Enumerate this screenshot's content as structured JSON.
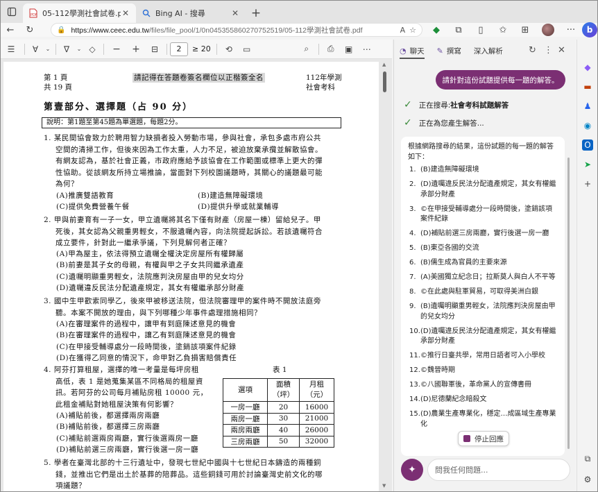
{
  "browser": {
    "tabs": [
      {
        "title": "05-112學測社會試卷.pdf",
        "active": true
      },
      {
        "title": "Bing AI - 搜尋",
        "active": false
      }
    ],
    "url_host": "https://www.ceec.edu.tw",
    "url_path": "/files/file_pool/1/0n045355860270752519/05-112學測社會試卷.pdf"
  },
  "pdf_toolbar": {
    "page_current": "2",
    "page_total_label": "≥ 20"
  },
  "pdf_page": {
    "header_left": [
      "第 1 頁",
      "共 19 頁"
    ],
    "header_center": "請記得在答題卷簽名欄位以正楷簽全名",
    "header_right": [
      "112年學測",
      "社會考科"
    ],
    "part_title": "第壹部分、選擇題（占 90 分）",
    "note": "說明：第1題至第45題為單選題，每題2分。",
    "q1": {
      "lines": [
        "1.  某民間協會致力於聘用智力缺損者投入勞動市場，參與社會，承包多處市府公共",
        "空間的清掃工作，但後來因為工作太重，人力不足，被迫放棄承攬並解散協會。",
        "有網友認為，基於社會正義，市政府應給予該協會在工作範圍或標準上更大的彈",
        "性協助。從該網友所持立場推論，當面對下列校園議題時，其關心的議題最可能",
        "為何？"
      ],
      "options": [
        "(A)推廣雙語教育",
        "(B)建造無障礙環境",
        "(C)提供免費營養午餐",
        "(D)提供升學或就業輔導"
      ]
    },
    "q2": {
      "lines": [
        "2.  甲與前妻育有一子一女，甲立遺囑將其名下僅有財產（房屋一棟）留給兒子。甲",
        "死後，其女認為父親重男輕女，不服遺囑內容，向法院提起訴訟。若該遺囑符合",
        "成立要件，針對此一繼承爭議，下列見解何者正確？"
      ],
      "options": [
        "(A)甲為屋主，依法得預立遺囑全權決定房屋所有權歸屬",
        "(B)前妻是其子女的母親，有權與甲之子女共同繼承遺產",
        "(C)遺囑明顯重男輕女，法院應判決房屋由甲的兒女均分",
        "(D)遺囑違反民法分配遺產規定，其女有權繼承部分財產"
      ]
    },
    "q3": {
      "lines": [
        "3.  國中生甲歡索同學乙，後來甲被移送法院，但法院審理甲的案件時不開放法庭旁",
        "聽。本案不開放的理由，與下列哪種少年事件處理措施相同？"
      ],
      "options": [
        "(A)在審理案件的過程中，讓甲有到庭陳述意見的機會",
        "(B)在審理案件的過程中，讓乙有到庭陳述意見的機會",
        "(C)在甲接受輔導處分一段時間後，塗銷該項案件紀錄",
        "(D)在獲得乙同意的情況下，命甲對乙負損害賠償責任"
      ]
    },
    "q4": {
      "lines": [
        "4.  阿芬打算租屋，選擇的唯一考量是每坪房租",
        "高低，表 1 是她蒐集某區不同格局的租屋資",
        "訊。若阿芬的公司每月補貼房租 10000 元，",
        "此租金補貼對她租屋決策有何影響？"
      ],
      "options": [
        "(A)補貼前後，都選擇兩房兩廳",
        "(B)補貼前後，都選擇三房兩廳",
        "(C)補貼前選兩房兩廳，實行後選兩房一廳",
        "(D)補貼前選三房兩廳，實行後選一房一廳"
      ],
      "table_caption": "表 1",
      "table_headers": [
        "選項",
        "面積",
        "（坪）",
        "月租",
        "（元）"
      ],
      "table_rows": [
        [
          "一房一廳",
          "20",
          "16000"
        ],
        [
          "兩房一廳",
          "30",
          "21000"
        ],
        [
          "兩房兩廳",
          "40",
          "26000"
        ],
        [
          "三房兩廳",
          "50",
          "32000"
        ]
      ]
    },
    "q5": {
      "lines": [
        "5.  學者在臺灣北部的十三行遺址中，發現七世紀中國與十七世紀日本鑄造的兩種銅",
        "錢，並推出它們是出土於基葬的陪葬品。這些銅錢可用於討論臺灣史前文化的哪",
        "項議題？"
      ]
    }
  },
  "sidebar": {
    "tabs": [
      "聊天",
      "撰寫",
      "深入解析"
    ],
    "user_message": "請針對這份試題提供每一題的解答。",
    "status_1_prefix": "正在搜尋: ",
    "status_1_query": "社會考科試題解答",
    "status_2": "正在為您產生解答...",
    "answer_intro": "根據網路搜尋的結果，這份試題的每一題的解答如下：",
    "answers": [
      {
        "n": "1.",
        "t": "(B)建造無障礙環境"
      },
      {
        "n": "2.",
        "t": "(D)遺囑違反民法分配遺產規定，其女有權繼承部分財產"
      },
      {
        "n": "3.",
        "t": "©在甲接受輔導處分一段時間後，塗銷該項案件紀錄"
      },
      {
        "n": "4.",
        "t": "(D)補貼前選三房兩廳，實行後選一房一廳"
      },
      {
        "n": "5.",
        "t": "(B)東亞各國的交流"
      },
      {
        "n": "6.",
        "t": "(B)儒生成為官員的主要來源"
      },
      {
        "n": "7.",
        "t": "(A)美國獨立紀念日；拉斯莫人與白人不平等"
      },
      {
        "n": "8.",
        "t": "©在此處與駐軍貿易，可取得美洲白銀"
      },
      {
        "n": "9.",
        "t": "(B)遺囑明顯重男輕女，法院應判決房屋由甲的兒女均分"
      },
      {
        "n": "10.",
        "t": "(D)遺囑違反民法分配遺產規定，其女有權繼承部分財產"
      },
      {
        "n": "11.",
        "t": "©推行日臺共學，常用日語者可入小學校"
      },
      {
        "n": "12.",
        "t": "©魏晉時期"
      },
      {
        "n": "13.",
        "t": "©八國聯軍後，革命黨人的宣傳書冊"
      },
      {
        "n": "14.",
        "t": "(D)尼德蘭紀念暗殺文"
      },
      {
        "n": "15.",
        "t": "(D)農業生產專業化，穩定…成區域生產專業化"
      }
    ],
    "stop_label": "停止回應",
    "ask_placeholder": "問我任何問題..."
  }
}
